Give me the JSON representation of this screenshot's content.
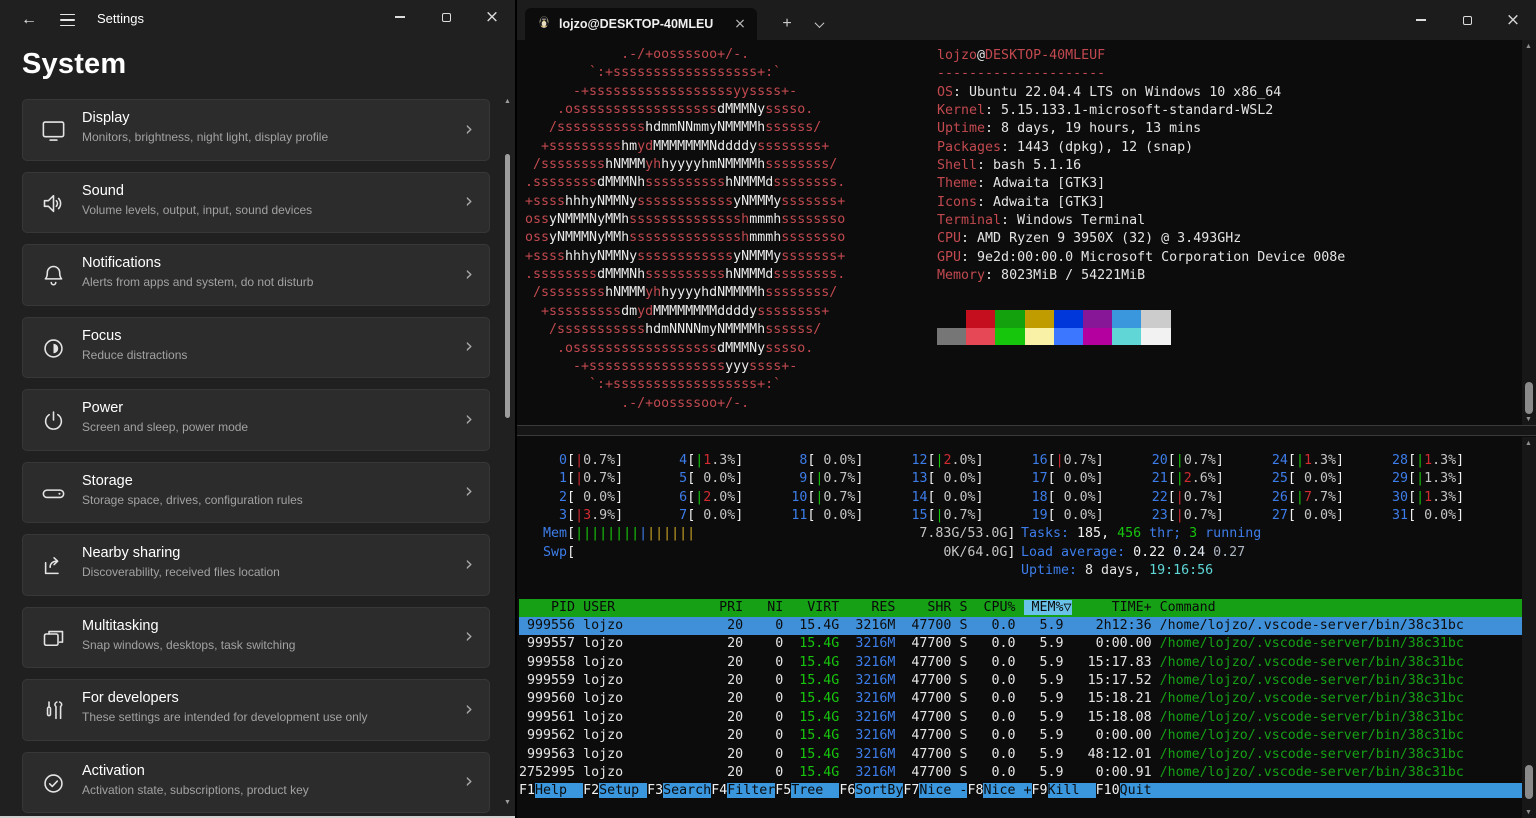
{
  "palette": {
    "red": "#c1494f",
    "bred": "#cf2b31",
    "green": "#16a016",
    "bgreen": "#17c50c",
    "yellow": "#c9a226",
    "blue": "#3d7dea",
    "cyan": "#5fd7d7",
    "bcyan": "#3a96dd",
    "white": "#f2f2f2",
    "artw": "#ececec",
    "gray": "#c5c5c5",
    "fg": "#e4e4e4",
    "dim": "#aeb6c2",
    "lgray": "#dfe7f0",
    "black": "#0c0c0c",
    "tfg": "#e6e6e6",
    "hdrfg": "#0a0a0a",
    "hdrbg": "#16a016",
    "sortbg": "#69c2ea",
    "selbg": "#3f90d8"
  },
  "settings": {
    "titlebar": {
      "title": "Settings"
    },
    "heading": "System",
    "items": [
      {
        "icon": "display-icon",
        "title": "Display",
        "subtitle": "Monitors, brightness, night light, display profile"
      },
      {
        "icon": "sound-icon",
        "title": "Sound",
        "subtitle": "Volume levels, output, input, sound devices"
      },
      {
        "icon": "notifications-icon",
        "title": "Notifications",
        "subtitle": "Alerts from apps and system, do not disturb"
      },
      {
        "icon": "focus-icon",
        "title": "Focus",
        "subtitle": "Reduce distractions"
      },
      {
        "icon": "power-icon",
        "title": "Power",
        "subtitle": "Screen and sleep, power mode"
      },
      {
        "icon": "storage-icon",
        "title": "Storage",
        "subtitle": "Storage space, drives, configuration rules"
      },
      {
        "icon": "nearby-sharing-icon",
        "title": "Nearby sharing",
        "subtitle": "Discoverability, received files location"
      },
      {
        "icon": "multitasking-icon",
        "title": "Multitasking",
        "subtitle": "Snap windows, desktops, task switching"
      },
      {
        "icon": "developers-icon",
        "title": "For developers",
        "subtitle": "These settings are intended for development use only"
      },
      {
        "icon": "activation-icon",
        "title": "Activation",
        "subtitle": "Activation state, subscriptions, product key"
      }
    ]
  },
  "terminal": {
    "tab": {
      "title": "lojzo@DESKTOP-40MLEU"
    },
    "neofetch": {
      "art": [
        [
          [
            "            .-/+oossssoo+/-.",
            "r"
          ]
        ],
        [
          [
            "        `:+ssssssssssssssssss+:`",
            "r"
          ]
        ],
        [
          [
            "      -+ssssssssssssssssssyyssss+-",
            "r"
          ]
        ],
        [
          [
            "    .ossssssssssssssssss",
            "r"
          ],
          [
            "dMMMNy",
            "w"
          ],
          [
            "sssso.",
            "r"
          ]
        ],
        [
          [
            "   /sssssssssss",
            "r"
          ],
          [
            "hdmmNNmmyNMMMMh",
            "w"
          ],
          [
            "ssssss/",
            "r"
          ]
        ],
        [
          [
            "  +sssssssss",
            "r"
          ],
          [
            "hm",
            "w"
          ],
          [
            "yd",
            "r"
          ],
          [
            "MMMMMMMNddddy",
            "w"
          ],
          [
            "ssssssss+",
            "r"
          ]
        ],
        [
          [
            " /ssssssss",
            "r"
          ],
          [
            "hNMMM",
            "w"
          ],
          [
            "yh",
            "r"
          ],
          [
            "hyyyyhmNMMMMh",
            "w"
          ],
          [
            "ssssssss/",
            "r"
          ]
        ],
        [
          [
            ".ssssssss",
            "r"
          ],
          [
            "dMMMNh",
            "w"
          ],
          [
            "ssssssssss",
            "r"
          ],
          [
            "hNMMMd",
            "w"
          ],
          [
            "ssssssss.",
            "r"
          ]
        ],
        [
          [
            "+ssss",
            "r"
          ],
          [
            "hhhyNMMNy",
            "w"
          ],
          [
            "ssssssssssss",
            "r"
          ],
          [
            "yNMMMy",
            "w"
          ],
          [
            "sssssss+",
            "r"
          ]
        ],
        [
          [
            "oss",
            "r"
          ],
          [
            "yNMMMNyMMh",
            "w"
          ],
          [
            "ssssssssssssssh",
            "r"
          ],
          [
            "mmmh",
            "w"
          ],
          [
            "ssssssso",
            "r"
          ]
        ],
        [
          [
            "oss",
            "r"
          ],
          [
            "yNMMMNyMMh",
            "w"
          ],
          [
            "ssssssssssssssh",
            "r"
          ],
          [
            "mmmh",
            "w"
          ],
          [
            "ssssssso",
            "r"
          ]
        ],
        [
          [
            "+ssss",
            "r"
          ],
          [
            "hhhyNMMNy",
            "w"
          ],
          [
            "ssssssssssss",
            "r"
          ],
          [
            "yNMMMy",
            "w"
          ],
          [
            "sssssss+",
            "r"
          ]
        ],
        [
          [
            ".ssssssss",
            "r"
          ],
          [
            "dMMMNh",
            "w"
          ],
          [
            "ssssssssss",
            "r"
          ],
          [
            "hNMMMd",
            "w"
          ],
          [
            "ssssssss.",
            "r"
          ]
        ],
        [
          [
            " /ssssssss",
            "r"
          ],
          [
            "hNMMM",
            "w"
          ],
          [
            "yh",
            "r"
          ],
          [
            "hyyyyhdNMMMMh",
            "w"
          ],
          [
            "ssssssss/",
            "r"
          ]
        ],
        [
          [
            "  +sssssssss",
            "r"
          ],
          [
            "dm",
            "w"
          ],
          [
            "yd",
            "r"
          ],
          [
            "MMMMMMMMddddy",
            "w"
          ],
          [
            "ssssssss+",
            "r"
          ]
        ],
        [
          [
            "   /sssssssssss",
            "r"
          ],
          [
            "hdmNNNNmyNMMMMh",
            "w"
          ],
          [
            "ssssss/",
            "r"
          ]
        ],
        [
          [
            "    .ossssssssssssssssss",
            "r"
          ],
          [
            "dMMMNy",
            "w"
          ],
          [
            "sssso.",
            "r"
          ]
        ],
        [
          [
            "      -+sssssssssssssssss",
            "r"
          ],
          [
            "yyy",
            "w"
          ],
          [
            "ssss+-",
            "r"
          ]
        ],
        [
          [
            "        `:+ssssssssssssssssss+:`",
            "r"
          ]
        ],
        [
          [
            "            .-/+oossssoo+/-.",
            "r"
          ]
        ]
      ],
      "info": [
        [
          [
            "lojzo",
            "red"
          ],
          [
            "@",
            "fg"
          ],
          [
            "DESKTOP-40MLEUF",
            "red"
          ]
        ],
        [
          [
            "---------------------",
            "red"
          ]
        ],
        [
          [
            "OS",
            "red"
          ],
          [
            ": Ubuntu 22.04.4 LTS on Windows 10 x86_64",
            "fg"
          ]
        ],
        [
          [
            "Kernel",
            "red"
          ],
          [
            ": 5.15.133.1-microsoft-standard-WSL2",
            "fg"
          ]
        ],
        [
          [
            "Uptime",
            "red"
          ],
          [
            ": 8 days, 19 hours, 13 mins",
            "fg"
          ]
        ],
        [
          [
            "Packages",
            "red"
          ],
          [
            ": 1443 (dpkg), 12 (snap)",
            "fg"
          ]
        ],
        [
          [
            "Shell",
            "red"
          ],
          [
            ": bash 5.1.16",
            "fg"
          ]
        ],
        [
          [
            "Theme",
            "red"
          ],
          [
            ": Adwaita [GTK3]",
            "fg"
          ]
        ],
        [
          [
            "Icons",
            "red"
          ],
          [
            ": Adwaita [GTK3]",
            "fg"
          ]
        ],
        [
          [
            "Terminal",
            "red"
          ],
          [
            ": Windows Terminal",
            "fg"
          ]
        ],
        [
          [
            "CPU",
            "red"
          ],
          [
            ": AMD Ryzen 9 3950X (32) @ 3.493GHz",
            "fg"
          ]
        ],
        [
          [
            "GPU",
            "red"
          ],
          [
            ": 9e2d:00:00.0 Microsoft Corporation Device 008e",
            "fg"
          ]
        ],
        [
          [
            "Memory",
            "red"
          ],
          [
            ": 8023MiB / 54221MiB",
            "fg"
          ]
        ]
      ],
      "blocks": {
        "row1": [
          "#0c0c0c",
          "#c50f1f",
          "#13a10e",
          "#c19c00",
          "#0037da",
          "#881798",
          "#3a96dd",
          "#cccccc"
        ],
        "row2": [
          "#767676",
          "#e74856",
          "#16c60c",
          "#f9f1a5",
          "#3b78ff",
          "#b4009e",
          "#61d6d6",
          "#f2f2f2"
        ]
      }
    },
    "htop": {
      "cpu_rows": [
        [
          {
            "id": 0,
            "b": "r",
            "pct": "0.7"
          },
          {
            "id": 4,
            "b": "g",
            "pct": "1.3",
            "hl": 1
          },
          {
            "id": 8,
            "b": null,
            "pct": "0.0"
          },
          {
            "id": 12,
            "b": "g",
            "pct": "2.0",
            "hl": 1
          },
          {
            "id": 16,
            "b": "r",
            "pct": "0.7"
          },
          {
            "id": 20,
            "b": "g",
            "pct": "0.7"
          },
          {
            "id": 24,
            "b": "g",
            "pct": "1.3",
            "hl": 1
          },
          {
            "id": 28,
            "b": "g",
            "pct": "1.3",
            "hl": 1
          }
        ],
        [
          {
            "id": 1,
            "b": "r",
            "pct": "0.7"
          },
          {
            "id": 5,
            "b": null,
            "pct": "0.0"
          },
          {
            "id": 9,
            "b": "g",
            "pct": "0.7"
          },
          {
            "id": 13,
            "b": null,
            "pct": "0.0"
          },
          {
            "id": 17,
            "b": null,
            "pct": "0.0"
          },
          {
            "id": 21,
            "b": "g",
            "pct": "2.6",
            "hl": 1
          },
          {
            "id": 25,
            "b": null,
            "pct": "0.0"
          },
          {
            "id": 29,
            "b": "g",
            "pct": "1.3"
          }
        ],
        [
          {
            "id": 2,
            "b": null,
            "pct": "0.0"
          },
          {
            "id": 6,
            "b": "g",
            "pct": "2.0",
            "hl": 1
          },
          {
            "id": 10,
            "b": "g",
            "pct": "0.7"
          },
          {
            "id": 14,
            "b": null,
            "pct": "0.0"
          },
          {
            "id": 18,
            "b": null,
            "pct": "0.0"
          },
          {
            "id": 22,
            "b": "r",
            "pct": "0.7"
          },
          {
            "id": 26,
            "b": "g",
            "pct": "7.7",
            "hl": 1
          },
          {
            "id": 30,
            "b": "g",
            "pct": "1.3",
            "hl": 1
          }
        ],
        [
          {
            "id": 3,
            "b": "r",
            "pct": "3.9",
            "hl": 1
          },
          {
            "id": 7,
            "b": null,
            "pct": "0.0"
          },
          {
            "id": 11,
            "b": null,
            "pct": "0.0"
          },
          {
            "id": 15,
            "b": "g",
            "pct": "0.7"
          },
          {
            "id": 19,
            "b": null,
            "pct": "0.0"
          },
          {
            "id": 23,
            "b": "r",
            "pct": "0.7"
          },
          {
            "id": 27,
            "b": null,
            "pct": "0.0"
          },
          {
            "id": 31,
            "b": null,
            "pct": "0.0"
          }
        ]
      ],
      "mem": {
        "label": "Mem",
        "bars": [
          [
            "bgreen",
            8
          ],
          [
            "blue",
            1
          ],
          [
            "yellow",
            6
          ]
        ],
        "width": 54,
        "text": "7.83G/53.0G"
      },
      "swp": {
        "label": "Swp",
        "bars": [],
        "width": 54,
        "text": "0K/64.0G"
      },
      "tasks_lines": [
        [
          [
            "Tasks: ",
            "blue"
          ],
          [
            "185, ",
            "white"
          ],
          [
            "456",
            "bgreen"
          ],
          [
            " thr; ",
            "blue"
          ],
          [
            "3",
            "bgreen"
          ],
          [
            " running",
            "blue"
          ]
        ],
        [
          [
            "Load average: ",
            "blue"
          ],
          [
            "0.22 ",
            "white"
          ],
          [
            "0.24 ",
            "lgray"
          ],
          [
            "0.27",
            "dim"
          ]
        ],
        [
          [
            "Uptime: ",
            "blue"
          ],
          [
            "8 days, ",
            "fg"
          ],
          [
            "19:16:56",
            "cyan"
          ]
        ]
      ],
      "columns": [
        {
          "label": "PID",
          "w": 7,
          "align": "r"
        },
        {
          "label": "USER",
          "w": 14,
          "align": "l"
        },
        {
          "label": "PRI",
          "w": 5,
          "align": "r"
        },
        {
          "label": "NI",
          "w": 4,
          "align": "r"
        },
        {
          "label": "VIRT",
          "w": 6,
          "align": "r"
        },
        {
          "label": "RES",
          "w": 6,
          "align": "r"
        },
        {
          "label": "SHR",
          "w": 6,
          "align": "r"
        },
        {
          "label": "S",
          "w": 1,
          "align": "l"
        },
        {
          "label": "CPU%",
          "w": 5,
          "align": "r"
        },
        {
          "label": "MEM%",
          "w": 5,
          "align": "r",
          "sort": true
        },
        {
          "label": "TIME+",
          "w": 10,
          "align": "r"
        },
        {
          "label": "Command",
          "w": 0,
          "align": "l"
        }
      ],
      "col_colors": {
        "4": "bgreen",
        "5": "blue",
        "11": "green"
      },
      "rows": [
        {
          "selected": true,
          "values": [
            "999556",
            "lojzo",
            "20",
            "0",
            "15.4G",
            "3216M",
            "47700",
            "S",
            "0.0",
            "5.9",
            "2h12:36",
            "/home/lojzo/.vscode-server/bin/38c31bc"
          ]
        },
        {
          "selected": false,
          "values": [
            "999557",
            "lojzo",
            "20",
            "0",
            "15.4G",
            "3216M",
            "47700",
            "S",
            "0.0",
            "5.9",
            "0:00.00",
            "/home/lojzo/.vscode-server/bin/38c31bc"
          ]
        },
        {
          "selected": false,
          "values": [
            "999558",
            "lojzo",
            "20",
            "0",
            "15.4G",
            "3216M",
            "47700",
            "S",
            "0.0",
            "5.9",
            "15:17.83",
            "/home/lojzo/.vscode-server/bin/38c31bc"
          ]
        },
        {
          "selected": false,
          "values": [
            "999559",
            "lojzo",
            "20",
            "0",
            "15.4G",
            "3216M",
            "47700",
            "S",
            "0.0",
            "5.9",
            "15:17.52",
            "/home/lojzo/.vscode-server/bin/38c31bc"
          ]
        },
        {
          "selected": false,
          "values": [
            "999560",
            "lojzo",
            "20",
            "0",
            "15.4G",
            "3216M",
            "47700",
            "S",
            "0.0",
            "5.9",
            "15:18.21",
            "/home/lojzo/.vscode-server/bin/38c31bc"
          ]
        },
        {
          "selected": false,
          "values": [
            "999561",
            "lojzo",
            "20",
            "0",
            "15.4G",
            "3216M",
            "47700",
            "S",
            "0.0",
            "5.9",
            "15:18.08",
            "/home/lojzo/.vscode-server/bin/38c31bc"
          ]
        },
        {
          "selected": false,
          "values": [
            "999562",
            "lojzo",
            "20",
            "0",
            "15.4G",
            "3216M",
            "47700",
            "S",
            "0.0",
            "5.9",
            "0:00.00",
            "/home/lojzo/.vscode-server/bin/38c31bc"
          ]
        },
        {
          "selected": false,
          "values": [
            "999563",
            "lojzo",
            "20",
            "0",
            "15.4G",
            "3216M",
            "47700",
            "S",
            "0.0",
            "5.9",
            "48:12.01",
            "/home/lojzo/.vscode-server/bin/38c31bc"
          ]
        },
        {
          "selected": false,
          "values": [
            "2752995",
            "lojzo",
            "20",
            "0",
            "15.4G",
            "3216M",
            "47700",
            "S",
            "0.0",
            "5.9",
            "0:00.91",
            "/home/lojzo/.vscode-server/bin/38c31bc"
          ]
        }
      ],
      "fnkeys": [
        {
          "key": "F1",
          "label": "Help  "
        },
        {
          "key": "F2",
          "label": "Setup "
        },
        {
          "key": "F3",
          "label": "Search"
        },
        {
          "key": "F4",
          "label": "Filter"
        },
        {
          "key": "F5",
          "label": "Tree  "
        },
        {
          "key": "F6",
          "label": "SortBy"
        },
        {
          "key": "F7",
          "label": "Nice -"
        },
        {
          "key": "F8",
          "label": "Nice +"
        },
        {
          "key": "F9",
          "label": "Kill  "
        },
        {
          "key": "F10",
          "label": "Quit"
        }
      ]
    }
  }
}
